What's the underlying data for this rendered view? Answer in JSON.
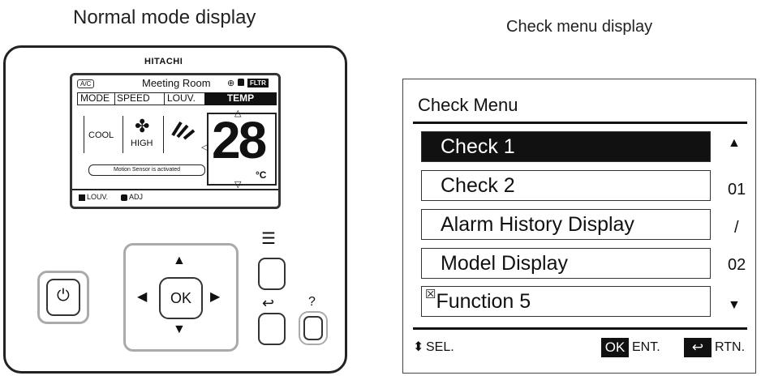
{
  "left_panel": {
    "title": "Normal mode display",
    "brand": "HITACHI",
    "lcd": {
      "ac_badge": "A/C",
      "room_name": "Meeting Room",
      "filter_badge": "FLTR",
      "tabs": [
        "MODE",
        "SPEED",
        "LOUV.",
        "TEMP"
      ],
      "mode": "COOL",
      "speed": "HIGH",
      "temperature": "28",
      "unit": "°C",
      "motion_sensor": "Motion Sensor is activated",
      "footer_louv": "LOUV.",
      "footer_adj": "ADJ"
    },
    "buttons": {
      "ok_label": "OK",
      "help_label": "?"
    }
  },
  "right_panel": {
    "title": "Check menu display",
    "menu_title": "Check Menu",
    "items": [
      "Check 1",
      "Check 2",
      "Alarm History Display",
      "Model Display",
      "Function 5"
    ],
    "selected_index": 0,
    "page_current": "01",
    "page_sep": "/",
    "page_total": "02",
    "footer": {
      "sel": "SEL.",
      "ok": "OK",
      "ent": "ENT.",
      "rtn": "RTN."
    }
  },
  "colors": {
    "selected_bg": "#111111",
    "button_ring": "#aaaaaa"
  }
}
